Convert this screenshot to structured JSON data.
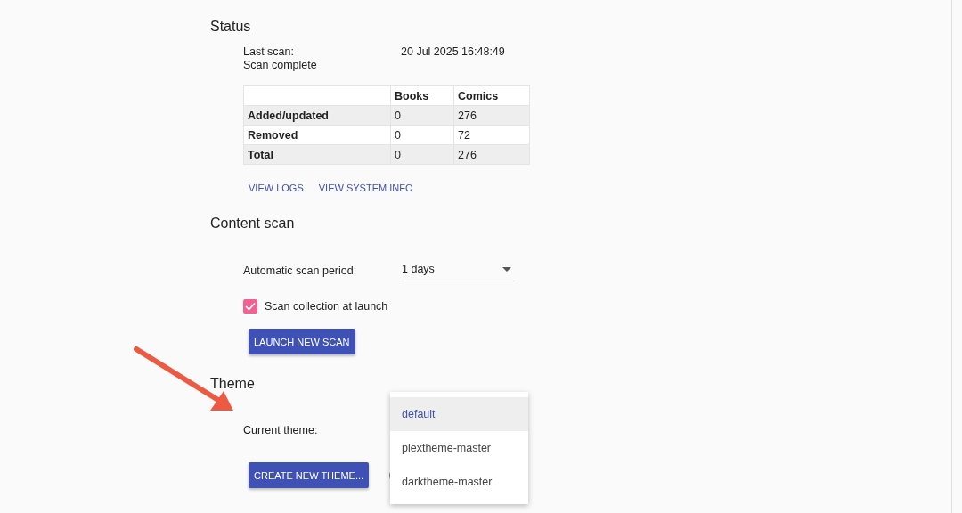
{
  "status": {
    "heading": "Status",
    "last_scan_label": "Last scan:",
    "last_scan_value": "20 Jul 2025 16:48:49",
    "scan_state": "Scan complete",
    "table": {
      "columns": [
        "Books",
        "Comics"
      ],
      "rows": [
        {
          "label": "Added/updated",
          "values": [
            "0",
            "276"
          ]
        },
        {
          "label": "Removed",
          "values": [
            "0",
            "72"
          ]
        },
        {
          "label": "Total",
          "values": [
            "0",
            "276"
          ]
        }
      ]
    },
    "links": [
      "VIEW LOGS",
      "VIEW SYSTEM INFO"
    ]
  },
  "content_scan": {
    "heading": "Content scan",
    "period_label": "Automatic scan period:",
    "period_value": "1 days",
    "checkbox": {
      "label": "Scan collection at launch",
      "checked": true
    },
    "button": "LAUNCH NEW SCAN"
  },
  "theme": {
    "heading": "Theme",
    "current_label": "Current theme:",
    "menu": [
      {
        "label": "default",
        "selected": true
      },
      {
        "label": "plextheme-master",
        "selected": false
      },
      {
        "label": "darktheme-master",
        "selected": false
      }
    ],
    "button": "CREATE NEW THEME..."
  }
}
